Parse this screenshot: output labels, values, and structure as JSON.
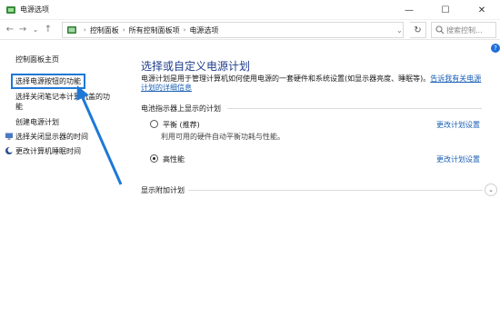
{
  "window": {
    "title": "电源选项",
    "minimize": "—",
    "maximize": "☐",
    "close": "✕"
  },
  "nav": {
    "back": "←",
    "forward": "→",
    "recent": "⌄",
    "up": "↑",
    "breadcrumb": [
      "控制面板",
      "所有控制面板项",
      "电源选项"
    ],
    "refresh": "↻",
    "search_placeholder": "搜索控制..."
  },
  "help": "?",
  "sidebar": {
    "items": [
      {
        "label": "控制面板主页"
      },
      {
        "label": "选择电源按钮的功能"
      },
      {
        "label": "选择关闭笔记本计算机盖的功"
      },
      {
        "label": "能"
      },
      {
        "label": "创建电源计划"
      },
      {
        "label": "选择关闭显示器的时间"
      },
      {
        "label": "更改计算机睡眠时间"
      }
    ]
  },
  "main": {
    "heading": "选择或自定义电源计划",
    "desc_text": "电源计划是用于管理计算机如何使用电源的一套硬件和系统设置(如显示器亮度、睡眠等)。",
    "desc_link": "告诉我有关电源计划的详细信息",
    "section_label": "电池指示器上显示的计划",
    "plans": [
      {
        "name": "平衡 (推荐)",
        "desc": "利用可用的硬件自动平衡功耗与性能。",
        "change": "更改计划设置",
        "selected": false
      },
      {
        "name": "高性能",
        "desc": "",
        "change": "更改计划设置",
        "selected": true
      }
    ],
    "more_label": "显示附加计划",
    "expand": "⌄"
  },
  "colors": {
    "heading": "#1f3d8a",
    "link": "#1a5fb4",
    "annotation": "#1e78d6"
  }
}
